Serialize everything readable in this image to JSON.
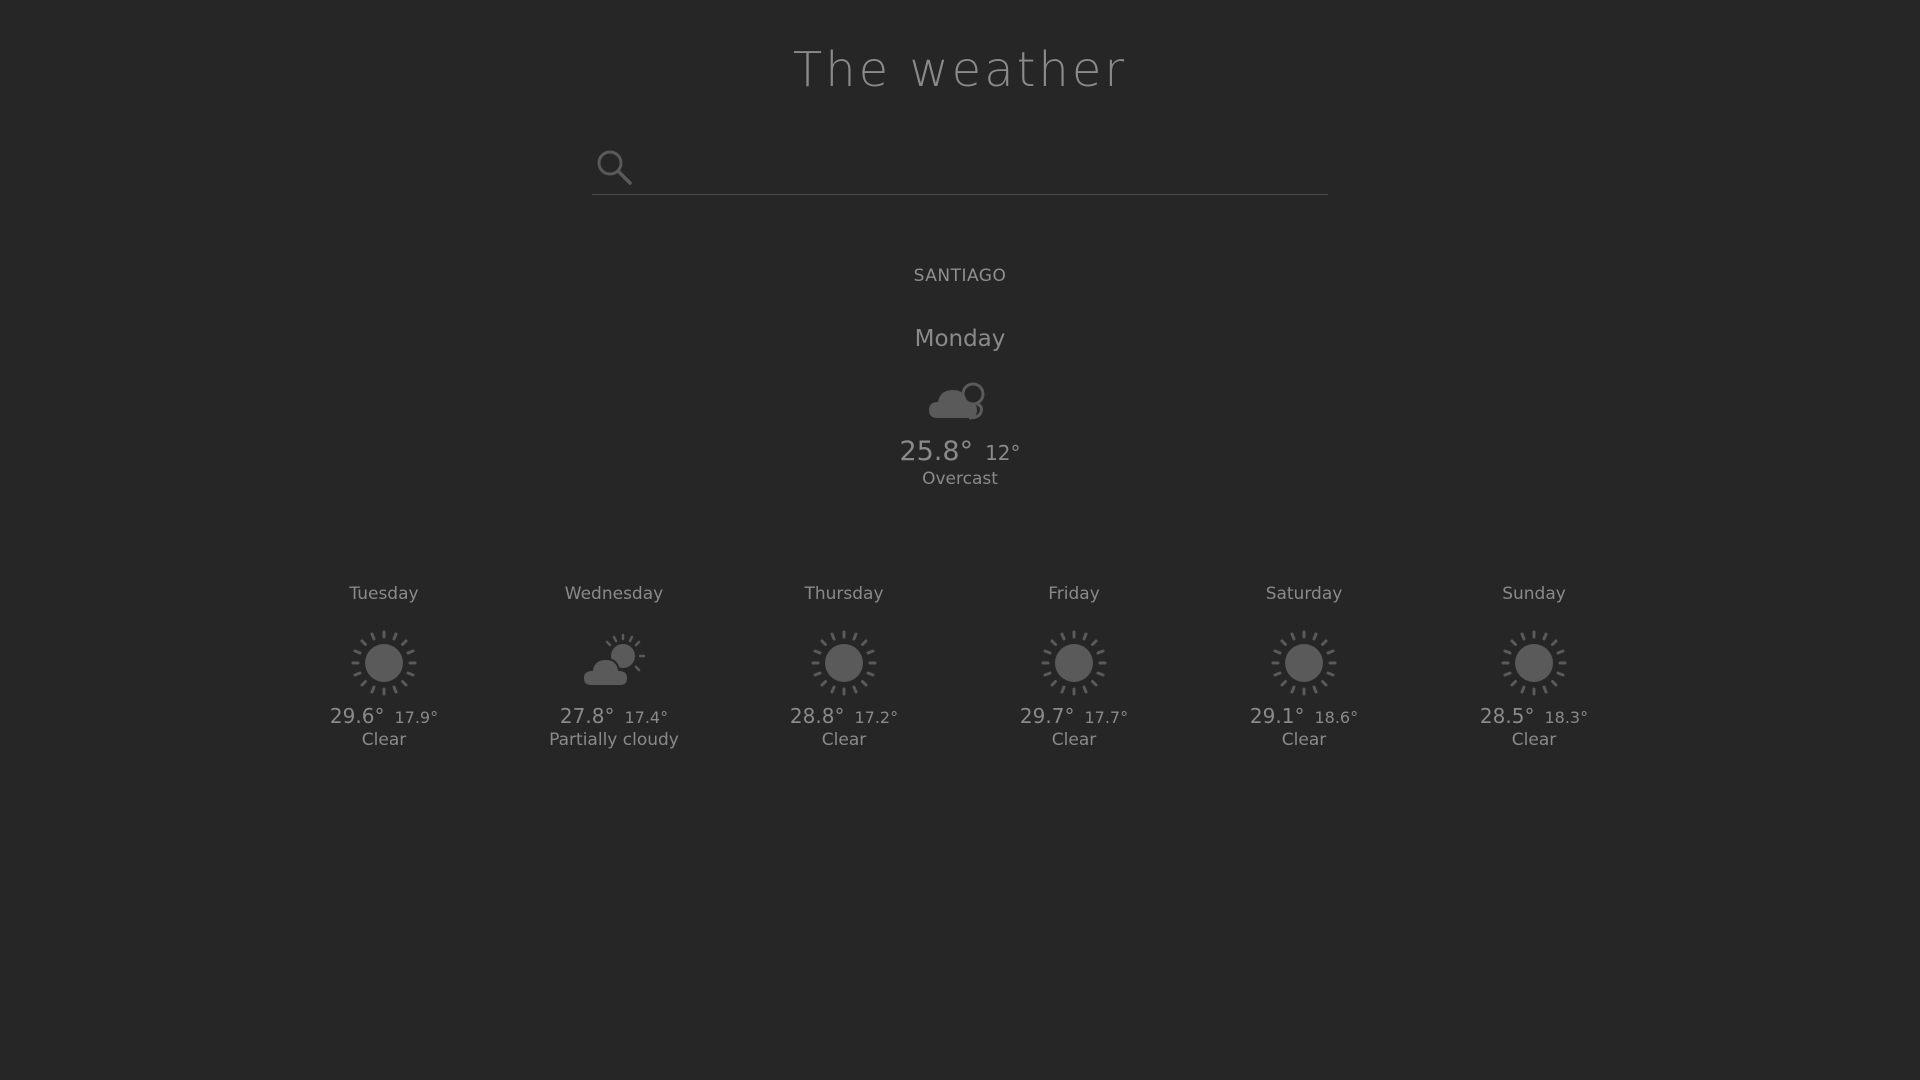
{
  "app": {
    "title": "The weather"
  },
  "search": {
    "value": "",
    "placeholder": "",
    "icon": "search-icon"
  },
  "location": {
    "city": "SANTIAGO"
  },
  "current": {
    "day": "Monday",
    "icon": "overcast-cloud-icon",
    "high": "25.8°",
    "low": "12°",
    "condition": "Overcast"
  },
  "forecast": [
    {
      "day": "Tuesday",
      "icon": "sun-icon",
      "high": "29.6°",
      "low": "17.9°",
      "condition": "Clear"
    },
    {
      "day": "Wednesday",
      "icon": "partly-cloudy-icon",
      "high": "27.8°",
      "low": "17.4°",
      "condition": "Partially cloudy"
    },
    {
      "day": "Thursday",
      "icon": "sun-icon",
      "high": "28.8°",
      "low": "17.2°",
      "condition": "Clear"
    },
    {
      "day": "Friday",
      "icon": "sun-icon",
      "high": "29.7°",
      "low": "17.7°",
      "condition": "Clear"
    },
    {
      "day": "Saturday",
      "icon": "sun-icon",
      "high": "29.1°",
      "low": "18.6°",
      "condition": "Clear"
    },
    {
      "day": "Sunday",
      "icon": "sun-icon",
      "high": "28.5°",
      "low": "18.3°",
      "condition": "Clear"
    }
  ],
  "colors": {
    "background": "#262626",
    "text": "#8a8a8a",
    "icon": "#5a5a5a",
    "underline": "#4a4a4a"
  }
}
